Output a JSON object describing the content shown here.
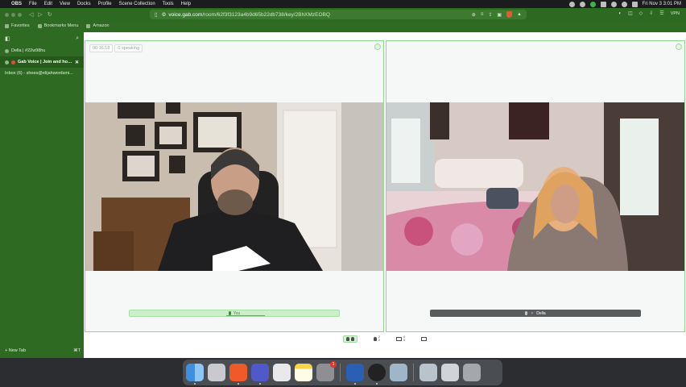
{
  "menubar": {
    "app_name": "OBS",
    "items": [
      "File",
      "Edit",
      "View",
      "Docks",
      "Profile",
      "Scene Collection",
      "Tools",
      "Help"
    ],
    "datetime": "Fri Nov 3  3:01 PM"
  },
  "browser": {
    "url_host": "voice.gab.com",
    "url_path": "/room/62f3f3123a4b9d65b22db738/key/2BhXMzEOBQ",
    "vpn_label": "VPN",
    "bookmarks": [
      "Favorites",
      "Bookmarks Menu",
      "Amazon"
    ]
  },
  "sidebar": {
    "items": [
      {
        "label": "Della | #22w98hu",
        "active": false,
        "closable": false
      },
      {
        "label": "Gab Voice | Join and host c",
        "active": true,
        "closable": true
      },
      {
        "label": "Inbox (6) - shoes@elijahwordsmi...",
        "active": false,
        "closable": false
      }
    ],
    "new_tab_label": "New Tab",
    "new_tab_shortcut": "⌘T"
  },
  "room": {
    "timer": "00:16:18",
    "speaking": "0 speaking",
    "participants": [
      {
        "name": "You",
        "active_speaker": true
      },
      {
        "name": "Della",
        "active_speaker": false
      }
    ],
    "controls": {
      "listeners_count_top": "2",
      "listeners_count_bottom": "2",
      "screens_count_top": "0",
      "screens_count_bottom": "0"
    }
  },
  "dock": {
    "apps": [
      "Finder",
      "Launchpad",
      "Brave Browser",
      "Microsoft Teams",
      "Screenshot",
      "Notes",
      "System Settings",
      "Microsoft Word",
      "OBS Studio",
      "Preview",
      "Downloads",
      "Screen Recording",
      "Trash"
    ],
    "settings_badge": "1"
  },
  "colors": {
    "accent": "#2f6a23",
    "tile_border": "#8ed58f",
    "active_namebar": "#cdeecb"
  }
}
